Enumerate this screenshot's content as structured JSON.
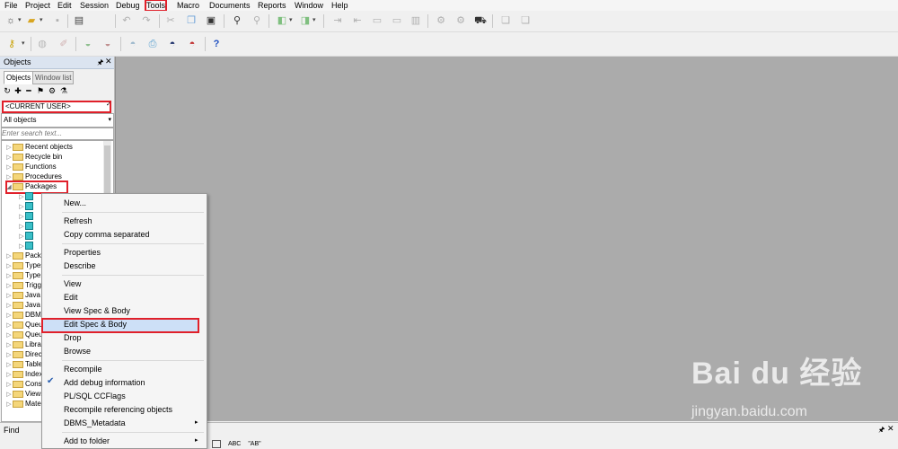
{
  "menu": {
    "items": [
      "File",
      "Project",
      "Edit",
      "Session",
      "Debug",
      "Tools",
      "Macro",
      "Documents",
      "Reports",
      "Window",
      "Help"
    ],
    "highlighted": "Tools"
  },
  "toolbar1": {
    "icons": [
      "new-icon",
      "open-icon",
      "save-icon",
      "undo-icon",
      "redo-icon",
      "cut-icon",
      "copy-icon",
      "paste-icon",
      "find-icon",
      "find-next-icon",
      "navigate-back-icon",
      "navigate-forward-icon",
      "indent-icon",
      "unindent-icon",
      "comment-icon",
      "uncomment-icon",
      "uppercase-icon",
      "lowercase-icon",
      "execute-icon",
      "stop-icon",
      "explain-plan-icon",
      "window-list-icon"
    ]
  },
  "toolbar2": {
    "icons": [
      "key-icon",
      "connect-icon",
      "disconnect-icon",
      "commit-icon",
      "rollback-icon",
      "database-icon",
      "print-icon",
      "preferences-icon",
      "help-icon"
    ],
    "help_glyph": "?"
  },
  "objects_panel": {
    "title": "Objects",
    "pin_glyph": "🖈",
    "close_glyph": "✕",
    "tabs": [
      "Objects",
      "Window list"
    ],
    "icon_glyphs": [
      "↻",
      "✚",
      "━",
      "⚑",
      "⚙",
      "⚗"
    ],
    "current_user": "<CURRENT USER>",
    "filter": "All objects",
    "search_placeholder": "Enter search text..."
  },
  "tree": {
    "top_items": [
      "Recent objects",
      "Recycle bin",
      "Functions",
      "Procedures",
      "Packages"
    ],
    "bottom_items": [
      "Packages bodies",
      "Types",
      "Type bodies",
      "Triggers",
      "Java sources",
      "Java classes",
      "DBMS_Jobs",
      "Queues",
      "Queue tables",
      "Libraries",
      "Directories",
      "Tables",
      "Indexes",
      "Constraints",
      "Views",
      "Materialized views"
    ],
    "collapsed_arrow": "▷",
    "expanded_arrow": "◢"
  },
  "context_menu": {
    "groups": [
      [
        "New..."
      ],
      [
        "Refresh",
        "Copy comma separated"
      ],
      [
        "Properties",
        "Describe"
      ],
      [
        "View",
        "Edit",
        "View Spec & Body",
        "Edit Spec & Body",
        "Drop",
        "Browse"
      ],
      [
        "Recompile",
        "Add debug information",
        "PL/SQL CCFlags",
        "Recompile referencing objects",
        "DBMS_Metadata"
      ],
      [
        "Add to folder"
      ]
    ],
    "highlighted": "Edit Spec & Body",
    "checked": "Add debug information",
    "submenu_items": [
      "DBMS_Metadata",
      "Add to folder"
    ],
    "check_glyph": "✔",
    "submenu_glyph": "▸"
  },
  "find_panel": {
    "label": "Find",
    "bottom_labels": [
      "ABC",
      "\"AB\""
    ]
  },
  "watermark": {
    "brand": "Bai du 经验",
    "url": "jingyan.baidu.com"
  },
  "colors": {
    "highlight_box": "#e0202a",
    "workspace": "#ababab",
    "panel_title": "#dbe4f0"
  }
}
